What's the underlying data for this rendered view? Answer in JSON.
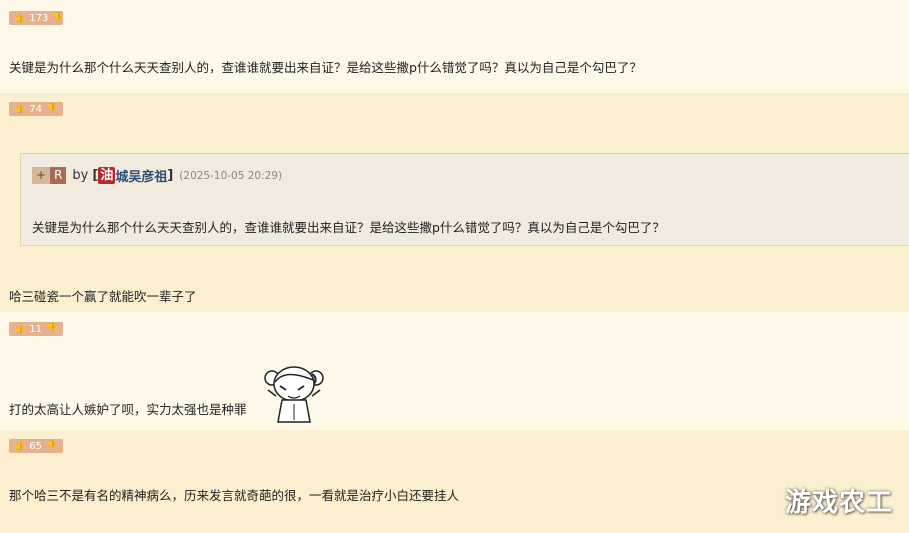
{
  "posts": [
    {
      "votes": "173",
      "text": "关键是为什么那个什么天天查别人的，查谁谁就要出来自证？是给这些撒p什么错觉了吗？真以为自己是个勾巴了？"
    },
    {
      "votes": "74",
      "quote": {
        "plus_label": "+",
        "r_label": "R",
        "by_label": "by",
        "bracket_open": "[",
        "user_badge": "油",
        "username": "城吴彦祖",
        "bracket_close": "]",
        "date": "(2025-10-05 20:29)",
        "text": "关键是为什么那个什么天天查别人的，查谁谁就要出来自证？是给这些撒p什么错觉了吗？真以为自己是个勾巴了？"
      },
      "text": "哈三碰瓷一个赢了就能吹一辈子了"
    },
    {
      "votes": "11",
      "text": "打的太高让人嫉妒了呗，实力太强也是种罪"
    },
    {
      "votes": "65",
      "text": "那个哈三不是有名的精神病么，历来发言就奇葩的很，一看就是治疗小白还要挂人"
    }
  ],
  "icons": {
    "upvote": "thumbs-up-icon",
    "downvote": "thumbs-down-icon"
  },
  "watermark": "游戏农工",
  "colors": {
    "vote_badge": "#e5b18f",
    "user_badge": "#b42a2a",
    "username": "#2e4c73"
  }
}
